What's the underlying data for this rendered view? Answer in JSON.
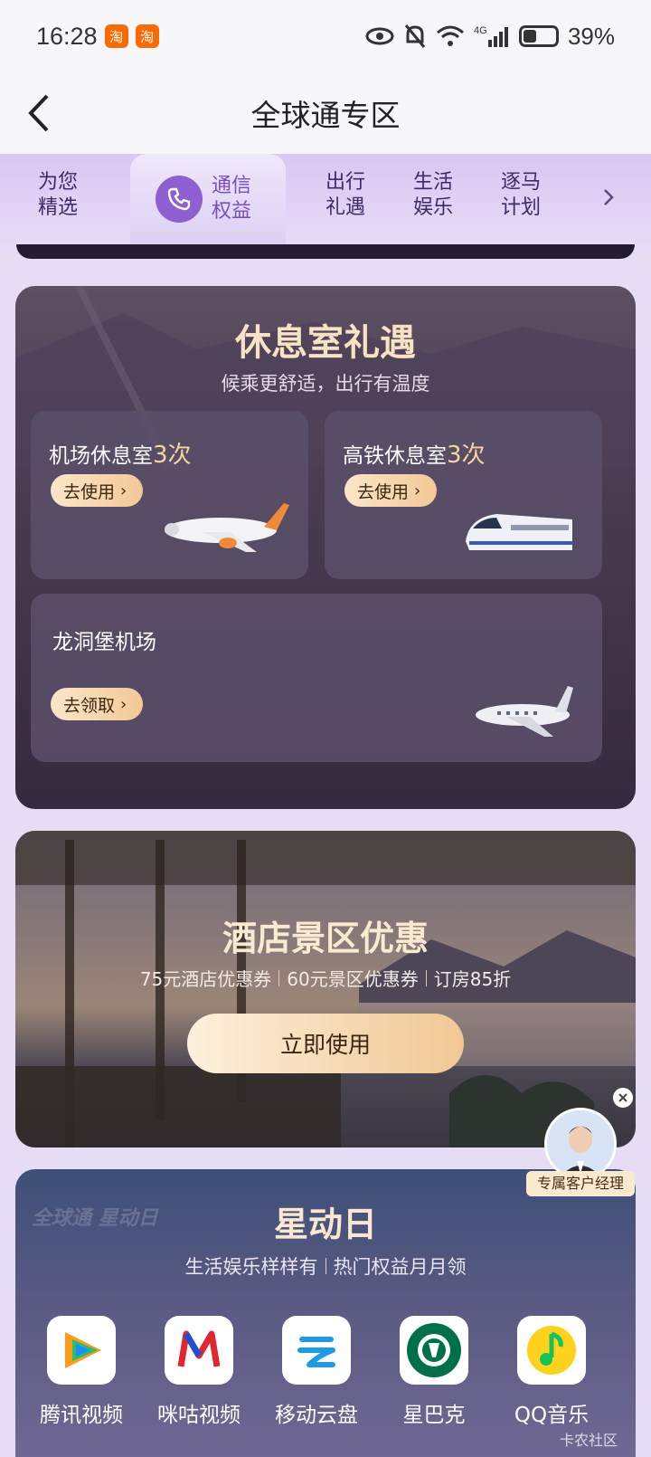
{
  "status_bar": {
    "time": "16:28",
    "notif_icons": [
      "淘",
      "淘"
    ],
    "battery": "39%",
    "network": "4G"
  },
  "header": {
    "title": "全球通专区"
  },
  "tabs": [
    {
      "line1": "为您",
      "line2": "精选"
    },
    {
      "line1": "通信",
      "line2": "权益",
      "active": true
    },
    {
      "line1": "出行",
      "line2": "礼遇"
    },
    {
      "line1": "生活",
      "line2": "娱乐"
    },
    {
      "line1": "逐马",
      "line2": "计划"
    }
  ],
  "lounge": {
    "title": "休息室礼遇",
    "subtitle": "候乘更舒适，出行有温度",
    "airport": {
      "label": "机场休息室",
      "count": "3次",
      "button": "去使用"
    },
    "rail": {
      "label": "高铁休息室",
      "count": "3次",
      "button": "去使用"
    },
    "longdongbao": {
      "label": "龙洞堡机场",
      "button": "去领取"
    }
  },
  "hotel": {
    "title": "酒店景区优惠",
    "offers": [
      "75元酒店优惠券",
      "60元景区优惠券",
      "订房85折"
    ],
    "button": "立即使用"
  },
  "manager": {
    "label": "专属客户经理"
  },
  "star_day": {
    "watermark": "全球通 星动日",
    "title": "星动日",
    "subtitle_left": "生活娱乐样样有",
    "subtitle_right": "热门权益月月领",
    "apps": [
      {
        "label": "腾讯视频",
        "icon": "tencent-video-icon"
      },
      {
        "label": "咪咕视频",
        "icon": "migu-video-icon"
      },
      {
        "label": "移动云盘",
        "icon": "mobile-cloud-icon"
      },
      {
        "label": "星巴克",
        "icon": "starbucks-icon"
      },
      {
        "label": "QQ音乐",
        "icon": "qq-music-icon"
      }
    ]
  },
  "page_watermark": "卡农社区",
  "colors": {
    "accent": "#8d5fd0",
    "gold": "#f3c896",
    "bg": "#e6dcf4"
  }
}
